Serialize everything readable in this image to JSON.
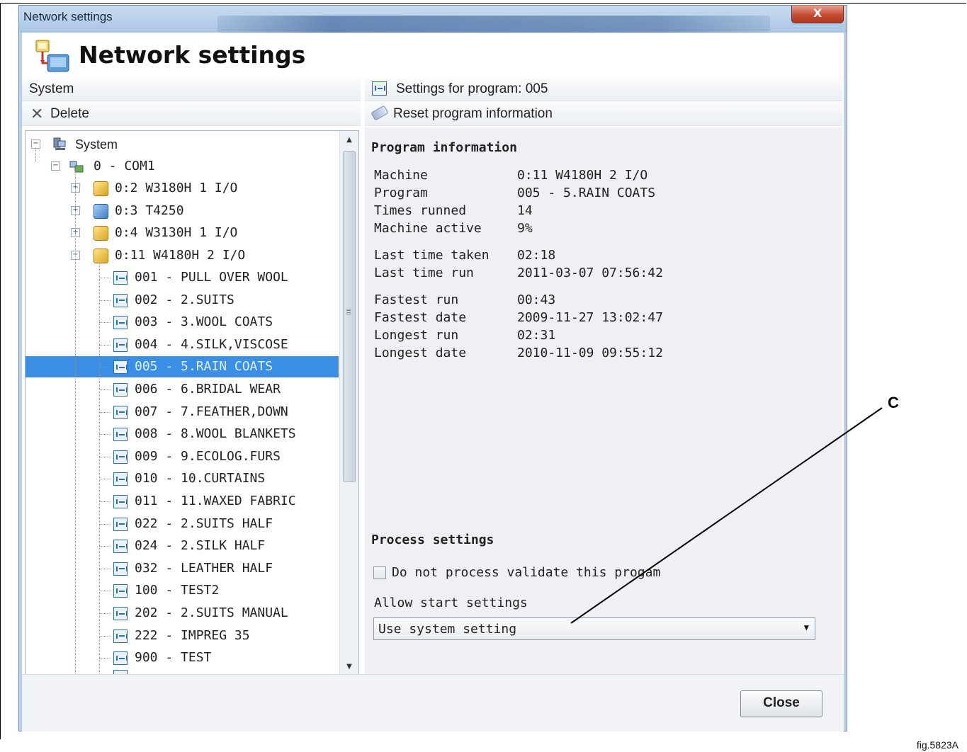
{
  "window": {
    "titlebar_text": "Network settings",
    "close_glyph": "X",
    "header_title": "Network settings"
  },
  "left": {
    "system_label": "System",
    "delete_label": "Delete"
  },
  "tree": {
    "root": "System",
    "port": "0 - COM1",
    "machines": [
      {
        "label": "0:2 W3180H 1 I/O",
        "icon": "machine-yellow",
        "expander": "+"
      },
      {
        "label": "0:3 T4250",
        "icon": "machine-blue",
        "expander": "+"
      },
      {
        "label": "0:4 W3130H 1 I/O",
        "icon": "machine-yellow",
        "expander": "+"
      },
      {
        "label": "0:11 W4180H 2 I/O",
        "icon": "machine-yellow",
        "expander": "-"
      }
    ],
    "programs": [
      "001 - PULL OVER WOOL",
      "002 - 2.SUITS",
      "003 - 3.WOOL COATS",
      "004 - 4.SILK,VISCOSE",
      "005 - 5.RAIN COATS",
      "006 - 6.BRIDAL WEAR",
      "007 - 7.FEATHER,DOWN",
      "008 - 8.WOOL BLANKETS",
      "009 - 9.ECOLOG.FURS",
      "010 - 10.CURTAINS",
      "011 - 11.WAXED FABRIC",
      "022 - 2.SUITS HALF",
      "024 - 2.SILK HALF",
      "032 - LEATHER HALF",
      "100 - TEST2",
      "202 - 2.SUITS MANUAL",
      "222 - IMPREG 35",
      "900 - TEST"
    ],
    "selected_program": "005 - 5.RAIN COATS"
  },
  "right": {
    "settings_header": "Settings for program: 005",
    "reset_label": "Reset program information",
    "program_info_title": "Program information",
    "info": [
      {
        "k": "Machine",
        "v": "0:11 W4180H 2 I/O"
      },
      {
        "k": "Program",
        "v": "005 - 5.RAIN COATS"
      },
      {
        "k": "Times runned",
        "v": "14"
      },
      {
        "k": "Machine active",
        "v": "9%"
      },
      {
        "k": "Last time taken",
        "v": "02:18"
      },
      {
        "k": "Last time run",
        "v": "2011-03-07 07:56:42"
      },
      {
        "k": "Fastest run",
        "v": "00:43"
      },
      {
        "k": "Fastest date",
        "v": "2009-11-27 13:02:47"
      },
      {
        "k": "Longest run",
        "v": "02:31"
      },
      {
        "k": "Longest date",
        "v": "2010-11-09 09:55:12"
      }
    ],
    "process_settings_title": "Process settings",
    "checkbox_label": "Do not process validate this progam",
    "checkbox_checked": false,
    "allow_start_label": "Allow start settings",
    "allow_start_value": "Use system setting"
  },
  "footer": {
    "close_label": "Close"
  },
  "annotations": {
    "callout": "C",
    "figure_id": "fig.5823A"
  }
}
